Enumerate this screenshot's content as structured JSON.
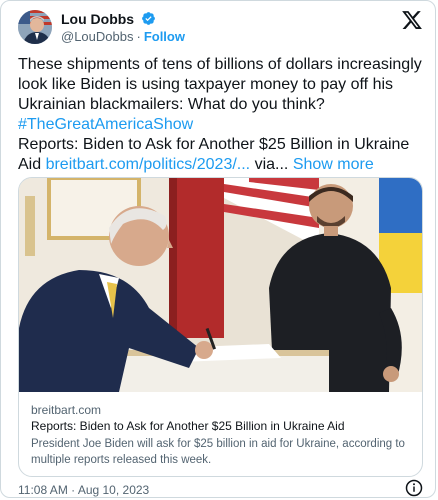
{
  "author": {
    "name": "Lou Dobbs",
    "handle": "@LouDobbs",
    "separator": "·",
    "follow_label": "Follow"
  },
  "icons": {
    "logo": "x-logo-icon",
    "verified": "verified-badge-icon",
    "info": "info-icon"
  },
  "tweet": {
    "text_main": "These shipments of tens of billions of dollars increasingly look like Biden is using taxpayer money to pay off his Ukrainian blackmailers:  What do you think?",
    "hashtag": "#TheGreatAmericaShow",
    "text_reports": " Reports: Biden to Ask for Another $25 Billion in Ukraine Aid ",
    "url": "breitbart.com/politics/2023/...",
    "via": " via...",
    "show_more": "Show more"
  },
  "card": {
    "domain": "breitbart.com",
    "headline": "Reports: Biden to Ask for Another $25 Billion in Ukraine Aid",
    "description": "President Joe Biden will ask for $25 billion in aid for Ukraine, according to multiple reports released this week."
  },
  "timestamp": "11:08 AM · Aug 10, 2023",
  "colors": {
    "accent": "#1d9bf0",
    "text": "#0f1419",
    "secondary": "#536471",
    "border": "#cfd9de"
  }
}
